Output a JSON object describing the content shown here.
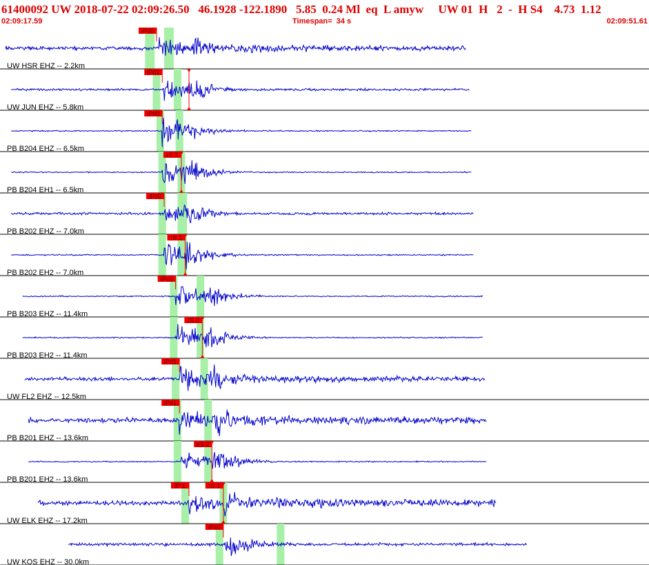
{
  "header": {
    "title": "61400092 UW 2018-07-22 02:09:26.50   46.1928 -122.1890   5.85  0.24 Ml  eq  L amyw     UW 01  H   2  -  H S4    4.73  1.12",
    "time_start": "02:09:17.59",
    "timespan_label": "Timespan=  34 s",
    "time_end": "02:09:51.61"
  },
  "colors": {
    "trace": "#0000cc",
    "pick": "#ee0000",
    "window": "#a8f0a8",
    "text": "#dd0000",
    "grid": "#000000"
  },
  "traces": [
    {
      "label": "UW HSR EHZ -- 2.2km",
      "picks": [
        {
          "label": "iPd0",
          "t": 8.2
        }
      ],
      "windows": [
        [
          7.6,
          8.1
        ],
        [
          8.6,
          9.1
        ]
      ],
      "data_span": [
        0.0,
        24.4
      ],
      "onset": 8.3,
      "amp": 6,
      "event": 10.1
    },
    {
      "label": "UW JUN EHZ -- 5.8km",
      "picks": [
        {
          "label": "iPd1",
          "t": 8.5
        },
        {
          "label": "",
          "t": 9.9,
          "marker": true
        }
      ],
      "windows": [
        [
          8.0,
          8.4
        ],
        [
          9.1,
          9.5
        ]
      ],
      "data_span": [
        0.3,
        24.6
      ],
      "onset": 8.6,
      "amp": 4,
      "event": 9.9
    },
    {
      "label": "PB B204 EHZ -- 6.5km",
      "picks": [
        {
          "label": "iPd0",
          "t": 8.5
        }
      ],
      "windows": [
        [
          8.2,
          8.6
        ],
        [
          9.2,
          9.6
        ]
      ],
      "data_span": [
        0.3,
        24.7
      ],
      "onset": 8.5,
      "amp": 2,
      "event": 9.2
    },
    {
      "label": "PB B204 EH1 -- 6.5km",
      "picks": [
        {
          "label": "rS 1",
          "t": 9.5,
          "marker": true
        }
      ],
      "windows": [
        [
          8.3,
          8.7
        ],
        [
          9.3,
          9.7
        ]
      ],
      "data_span": [
        0.3,
        24.7
      ],
      "onset": 8.5,
      "amp": 2,
      "event": 9.5
    },
    {
      "label": "PB B202 EHZ -- 7.0km",
      "picks": [
        {
          "label": "iPc0",
          "t": 8.6
        }
      ],
      "windows": [
        [
          8.3,
          8.7
        ],
        [
          9.3,
          9.8
        ]
      ],
      "data_span": [
        0.3,
        24.8
      ],
      "onset": 8.6,
      "amp": 4,
      "event": 9.6
    },
    {
      "label": "PB B202 EH2 -- 7.0km",
      "picks": [
        {
          "label": "rS 1",
          "t": 9.7,
          "marker": true
        }
      ],
      "windows": [
        [
          8.3,
          8.7
        ],
        [
          9.3,
          9.8
        ]
      ],
      "data_span": [
        0.3,
        24.8
      ],
      "onset": 8.6,
      "amp": 2,
      "event": 9.7
    },
    {
      "label": "PB B203 EHZ -- 11.4km",
      "picks": [
        {
          "label": "iPc0",
          "t": 9.2
        }
      ],
      "windows": [
        [
          8.9,
          9.3
        ],
        [
          10.3,
          10.7
        ]
      ],
      "data_span": [
        0.9,
        25.3
      ],
      "onset": 9.2,
      "amp": 2,
      "event": 10.7
    },
    {
      "label": "PB B203 EH2 -- 11.4km",
      "picks": [
        {
          "label": "rS 0",
          "t": 10.6,
          "marker": true
        }
      ],
      "windows": [
        [
          8.9,
          9.3
        ],
        [
          10.3,
          10.7
        ]
      ],
      "data_span": [
        0.9,
        25.3
      ],
      "onset": 9.2,
      "amp": 2,
      "event": 10.7
    },
    {
      "label": "UW FL2 EHZ -- 12.5km",
      "picks": [
        {
          "label": "iPd1",
          "t": 9.4
        }
      ],
      "windows": [
        [
          9.0,
          9.4
        ],
        [
          10.5,
          10.9
        ]
      ],
      "data_span": [
        1.0,
        25.4
      ],
      "onset": 9.4,
      "amp": 6,
      "event": 11.0
    },
    {
      "label": "PB B201 EHZ -- 13.6km",
      "picks": [
        {
          "label": "iPd1",
          "t": 9.4
        }
      ],
      "windows": [
        [
          9.1,
          9.5
        ],
        [
          10.7,
          11.1
        ]
      ],
      "data_span": [
        1.2,
        25.5
      ],
      "onset": 9.4,
      "amp": 8,
      "event": 11.3
    },
    {
      "label": "PB B201 EH2 -- 13.6km",
      "picks": [
        {
          "label": "eS 2",
          "t": 11.1,
          "marker": true
        }
      ],
      "windows": [
        [
          9.1,
          9.5
        ],
        [
          10.7,
          11.1
        ]
      ],
      "data_span": [
        1.2,
        25.5
      ],
      "onset": 9.5,
      "amp": 2,
      "event": 11.1
    },
    {
      "label": "UW ELK EHZ -- 17.2km",
      "picks": [
        {
          "label": "iP 1",
          "t": 9.9
        },
        {
          "label": "rS 1",
          "t": 11.7,
          "marker": true
        }
      ],
      "windows": [
        [
          9.5,
          9.9
        ],
        [
          11.5,
          11.9
        ]
      ],
      "data_span": [
        1.7,
        26.0
      ],
      "onset": 9.9,
      "amp": 8,
      "event": 11.7
    },
    {
      "label": "UW KOS EHZ -- 30.0km",
      "picks": [
        {
          "label": "iPc0",
          "t": 11.7
        }
      ],
      "windows": [
        [
          11.3,
          11.7
        ],
        [
          14.5,
          14.9
        ]
      ],
      "data_span": [
        3.3,
        27.6
      ],
      "onset": 11.7,
      "amp": 5,
      "event": 11.9
    }
  ]
}
